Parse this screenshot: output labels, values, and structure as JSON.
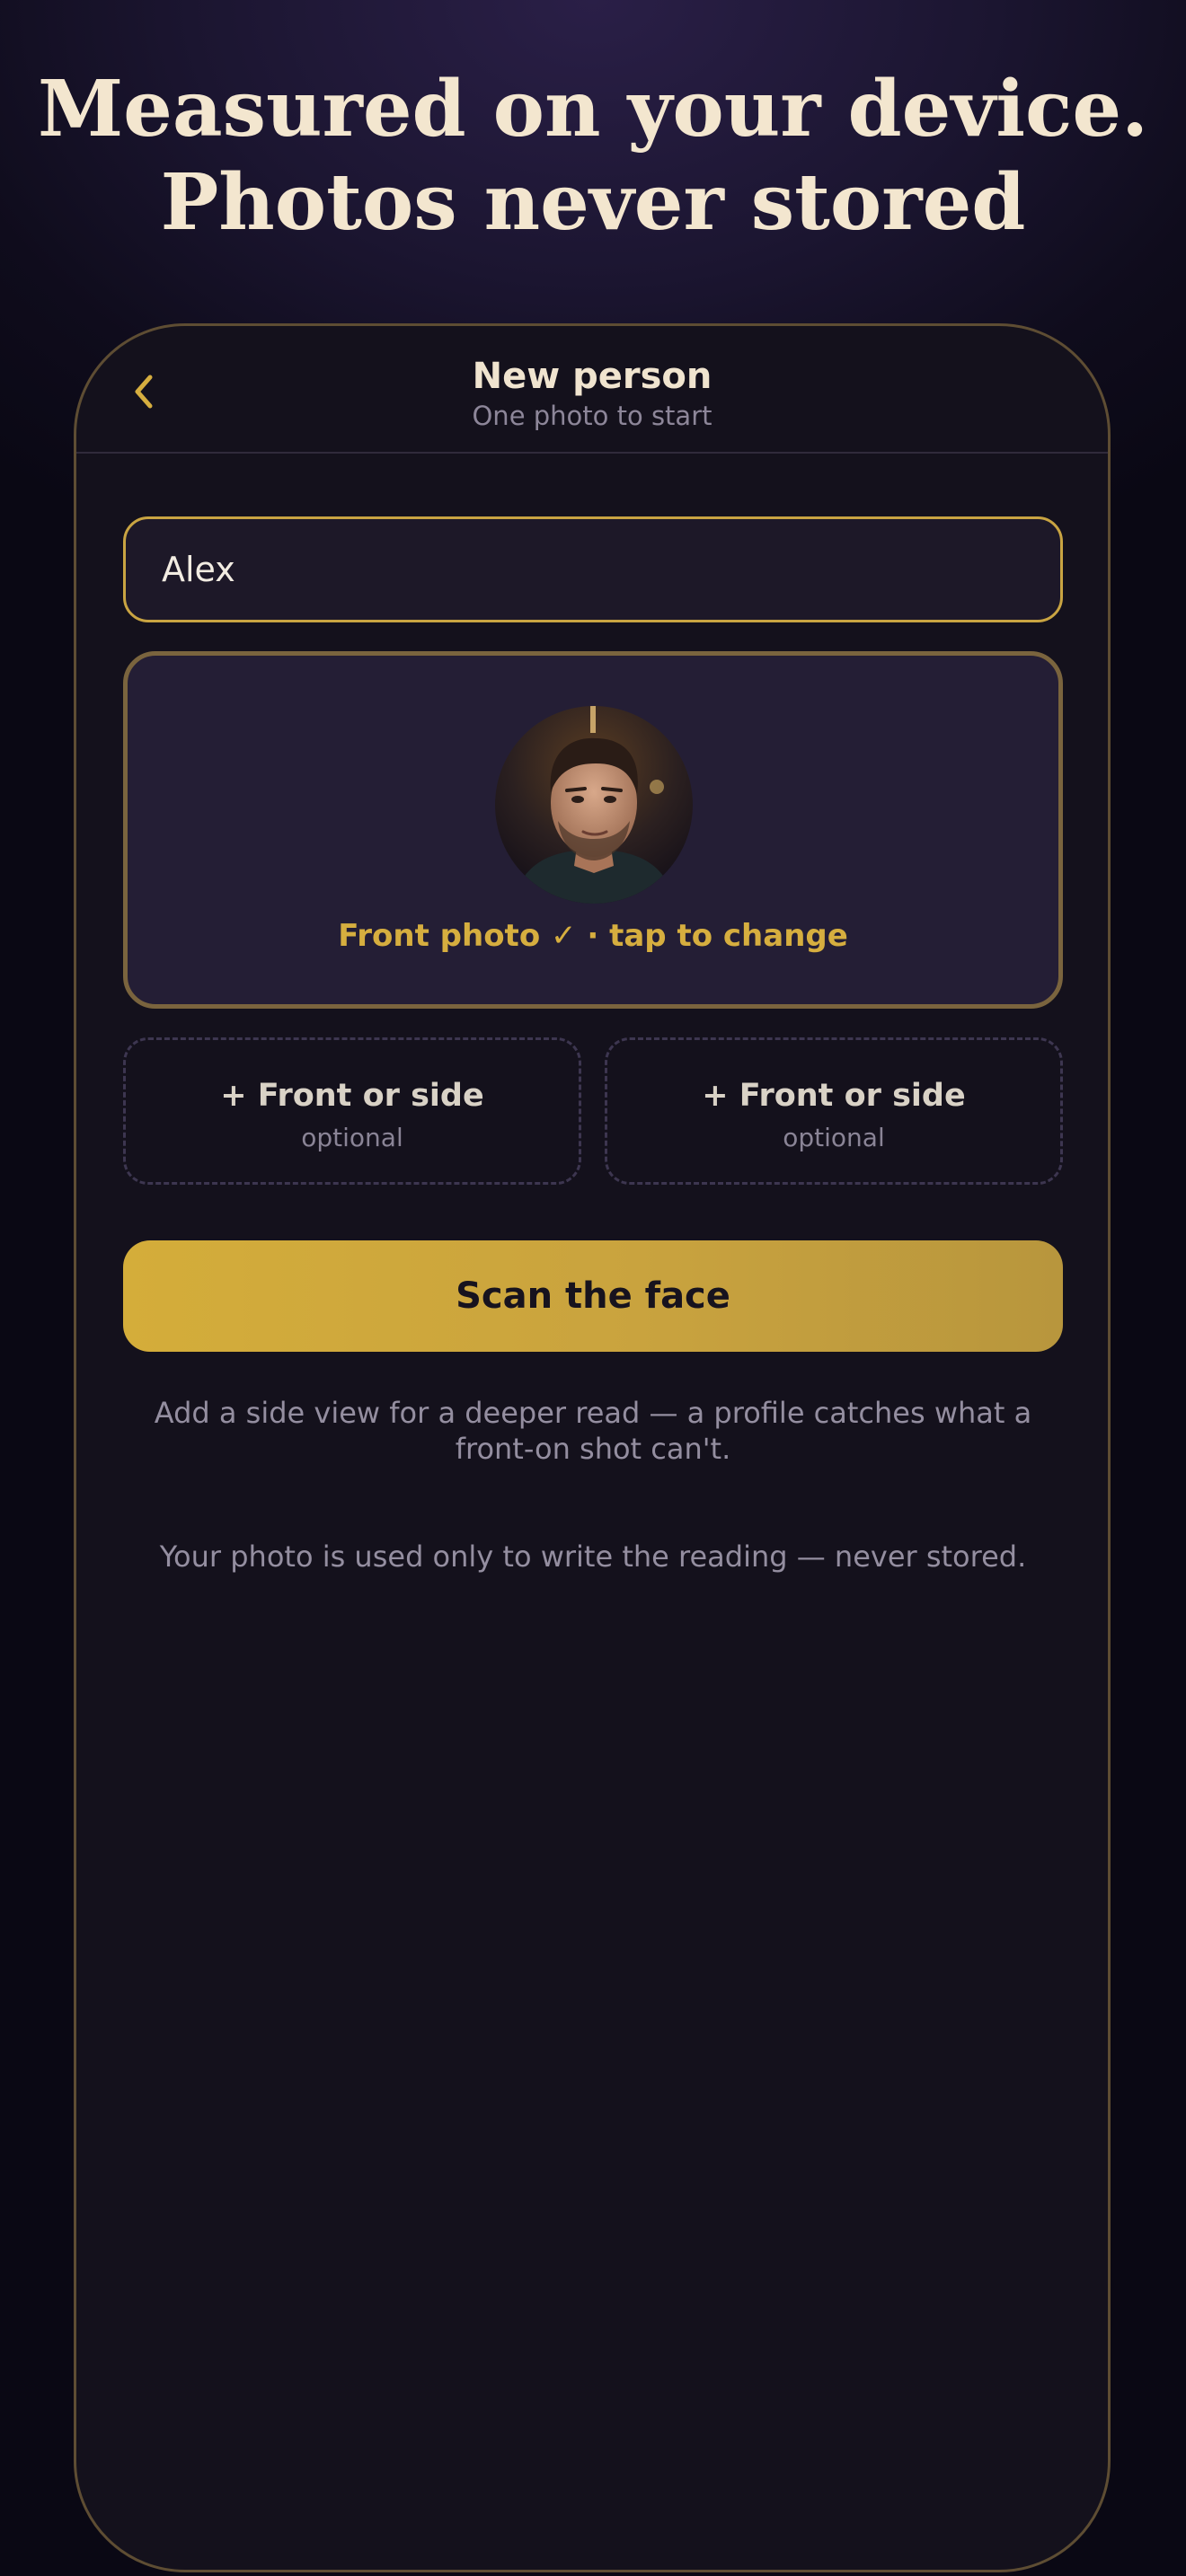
{
  "headline": {
    "line1": "Measured on your device.",
    "line2": "Photos never stored"
  },
  "header": {
    "back_icon": "chevron-left-icon",
    "title": "New person",
    "subtitle": "One photo to start"
  },
  "name_field": {
    "value": "Alex"
  },
  "photo_card": {
    "caption": "Front photo ✓ · tap to change"
  },
  "extra_slots": [
    {
      "label": "+ Front or side",
      "sublabel": "optional"
    },
    {
      "label": "+ Front or side",
      "sublabel": "optional"
    }
  ],
  "scan_button": {
    "label": "Scan the face"
  },
  "hint_text": "Add a side view for a deeper read — a profile catches what a front-on shot can't.",
  "privacy_text": "Your photo is used only to write the reading — never stored.",
  "colors": {
    "accent_gold": "#d6ae3f",
    "background": "#14111c",
    "headline": "#f3e6cf"
  }
}
